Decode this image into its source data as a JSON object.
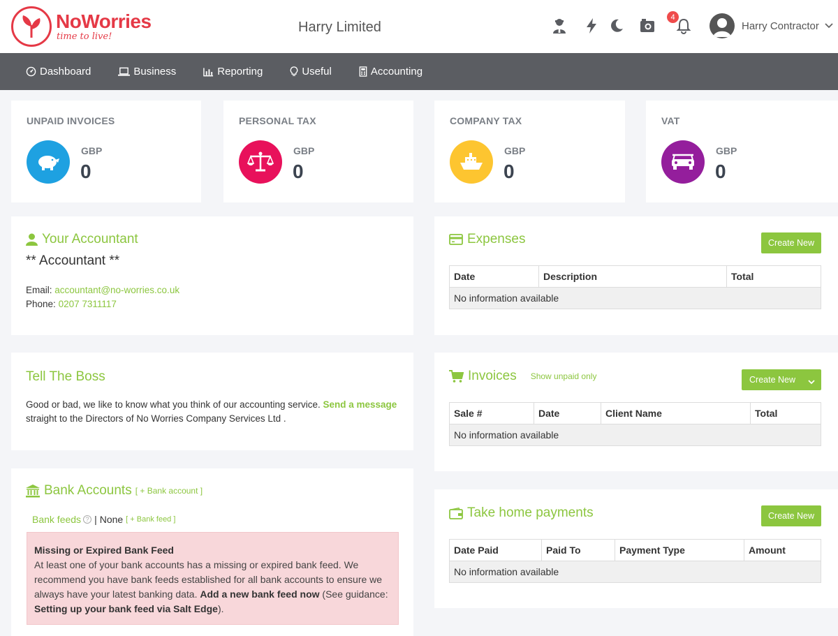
{
  "brand": {
    "name": "NoWorries",
    "tagline": "time to live!",
    "color": "#e53946"
  },
  "header": {
    "company": "Harry Limited",
    "notifications_count": "4",
    "user_name": "Harry Contractor",
    "icons": [
      "user-tie-icon",
      "lightning-icon",
      "moon-icon",
      "camera-icon",
      "bell-icon"
    ]
  },
  "nav": {
    "items": [
      {
        "label": "Dashboard",
        "icon": "dashboard-icon"
      },
      {
        "label": "Business",
        "icon": "laptop-icon"
      },
      {
        "label": "Reporting",
        "icon": "bar-chart-icon"
      },
      {
        "label": "Useful",
        "icon": "lightbulb-icon"
      },
      {
        "label": "Accounting",
        "icon": "calculator-icon"
      }
    ]
  },
  "stats": [
    {
      "title": "UNPAID INVOICES",
      "currency": "GBP",
      "value": "0",
      "color": "#1ea1e1",
      "icon": "piggy-bank-icon"
    },
    {
      "title": "PERSONAL TAX",
      "currency": "GBP",
      "value": "0",
      "color": "#e8115b",
      "icon": "scales-icon"
    },
    {
      "title": "COMPANY TAX",
      "currency": "GBP",
      "value": "0",
      "color": "#fdc530",
      "icon": "ship-icon"
    },
    {
      "title": "VAT",
      "currency": "GBP",
      "value": "0",
      "color": "#941e9c",
      "icon": "car-icon"
    }
  ],
  "accountant": {
    "title": "Your Accountant",
    "name": "** Accountant **",
    "email_label": "Email:",
    "email": "accountant@no-worries.co.uk",
    "phone_label": "Phone:",
    "phone": "0207 7311117"
  },
  "boss": {
    "title": "Tell The Boss",
    "text1": "Good or bad, we like to know what you think of our accounting service.",
    "link": "Send a message",
    "text2": "straight to the Directors of No Worries Company Services Ltd ."
  },
  "bank": {
    "title": "Bank Accounts",
    "add_account": "[ + Bank account ]",
    "feeds_label": "Bank feeds",
    "feeds_sep": "|",
    "feeds_value": "None",
    "add_feed": "[ + Bank feed ]",
    "alert_title": "Missing or Expired Bank Feed",
    "alert_text1": "At least one of your bank accounts has a missing or expired bank feed. We recommend you have bank feeds established for all bank accounts to ensure we always have your latest banking data.",
    "alert_link": "Add a new bank feed now",
    "alert_text2": "(See guidance:",
    "alert_guide": "Setting up your bank feed via Salt Edge",
    "alert_text3": ")."
  },
  "expenses": {
    "title": "Expenses",
    "button": "Create New",
    "columns": [
      "Date",
      "Description",
      "Total"
    ],
    "empty": "No information available"
  },
  "invoices": {
    "title": "Invoices",
    "filter": "Show unpaid only",
    "button": "Create New",
    "columns": [
      "Sale #",
      "Date",
      "Client Name",
      "Total"
    ],
    "empty": "No information available"
  },
  "payments": {
    "title": "Take home payments",
    "button": "Create New",
    "columns": [
      "Date Paid",
      "Paid To",
      "Payment Type",
      "Amount"
    ],
    "empty": "No information available"
  },
  "accent": "#8cc63f"
}
